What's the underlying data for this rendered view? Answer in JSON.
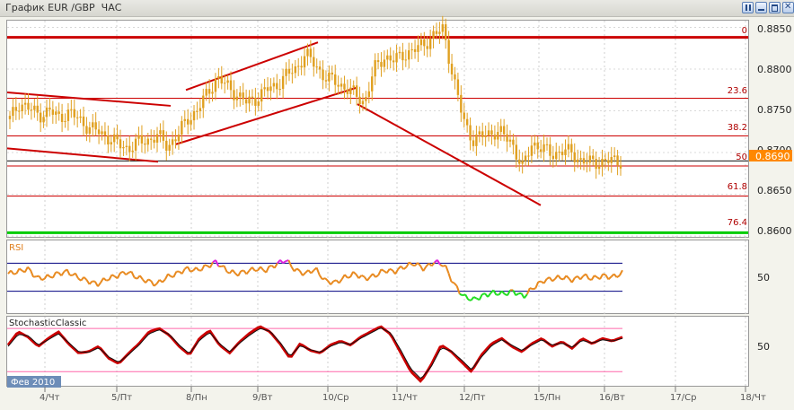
{
  "window": {
    "title": "График EUR /GBP  ЧАС",
    "buttons": [
      "pause",
      "minimize",
      "maximize",
      "close"
    ]
  },
  "price_panel": {
    "y_ticks": [
      "0.8850",
      "0.8800",
      "0.8750",
      "0.8700",
      "0.8650",
      "0.8600"
    ],
    "current_price": "0.8690",
    "fib_labels": [
      "0",
      "23.6",
      "38.2",
      "50",
      "61.8",
      "76.4"
    ],
    "colors": {
      "candles": "#e0a020",
      "fib": "#cc0000",
      "level_100": "#00cc00",
      "trend": "#cc0000",
      "price_tag": "#ff8800"
    }
  },
  "rsi_panel": {
    "label": "RSI",
    "y_tick": "50",
    "colors": {
      "line": "#e88a20",
      "overbought": "#dd22dd",
      "oversold": "#22dd22",
      "levels": "#000080"
    }
  },
  "stoch_panel": {
    "label": "StochasticClassic",
    "y_tick": "50",
    "colors": {
      "main": "#cc0000",
      "signal": "#111111",
      "levels": "#ff66aa"
    }
  },
  "date_badge": "Фев 2010",
  "x_ticks": [
    "4/Чт",
    "5/Пт",
    "8/Пн",
    "9/Вт",
    "10/Ср",
    "11/Чт",
    "12/Пт",
    "15/Пн",
    "16/Вт",
    "17/Ср",
    "18/Чт"
  ],
  "chart_data": [
    {
      "type": "candlestick",
      "title": "EUR /GBP",
      "x": [
        "4/Чт",
        "5/Пт",
        "8/Пн",
        "9/Вт",
        "10/Ср",
        "11/Чт",
        "12/Пт",
        "15/Пн",
        "16/Вт",
        "17/Ср",
        "18/Чт"
      ],
      "close_path": [
        0.874,
        0.876,
        0.8752,
        0.8745,
        0.875,
        0.8742,
        0.8748,
        0.874,
        0.873,
        0.8725,
        0.8718,
        0.871,
        0.8705,
        0.8712,
        0.8715,
        0.872,
        0.8708,
        0.872,
        0.874,
        0.875,
        0.877,
        0.879,
        0.878,
        0.877,
        0.876,
        0.8765,
        0.8775,
        0.878,
        0.8792,
        0.88,
        0.8818,
        0.8805,
        0.879,
        0.8785,
        0.8778,
        0.877,
        0.876,
        0.88,
        0.8815,
        0.881,
        0.8818,
        0.8822,
        0.883,
        0.884,
        0.8848,
        0.879,
        0.874,
        0.8715,
        0.872,
        0.8725,
        0.8722,
        0.8712,
        0.868,
        0.8712,
        0.8705,
        0.8698,
        0.8702,
        0.87,
        0.869,
        0.8688,
        0.8689,
        0.869,
        0.869
      ],
      "ylim": [
        0.8598,
        0.8858
      ],
      "current_price": 0.869,
      "fibonacci": [
        {
          "label": "0",
          "price": 0.8838
        },
        {
          "label": "23.6",
          "price": 0.8765
        },
        {
          "label": "38.2",
          "price": 0.872
        },
        {
          "label": "50",
          "price": 0.8684
        },
        {
          "label": "61.8",
          "price": 0.8648
        },
        {
          "label": "76.4",
          "price": 0.8604
        }
      ],
      "horizontal_line": 0.869,
      "trendlines": [
        {
          "from": [
            "4/Чт",
            0.8772
          ],
          "to": [
            "8/Пн",
            0.8756
          ]
        },
        {
          "from": [
            "4/Чт",
            0.8705
          ],
          "to": [
            "8/Пн",
            0.8689
          ]
        },
        {
          "from": [
            "8/Пн",
            0.8775
          ],
          "to": [
            "10/Ср",
            0.8832
          ]
        },
        {
          "from": [
            "8/Пн",
            0.871
          ],
          "to": [
            "11/Чт",
            0.8778
          ]
        },
        {
          "from": [
            "11/Чт",
            0.8758
          ],
          "to": [
            "15/Пн",
            0.8637
          ]
        }
      ]
    },
    {
      "type": "line",
      "title": "RSI",
      "ylim": [
        0,
        100
      ],
      "levels": [
        70,
        30
      ],
      "values": [
        55,
        58,
        62,
        48,
        50,
        55,
        58,
        50,
        45,
        40,
        48,
        52,
        58,
        50,
        45,
        40,
        50,
        55,
        62,
        60,
        65,
        72,
        60,
        55,
        58,
        62,
        60,
        68,
        75,
        60,
        55,
        62,
        45,
        42,
        50,
        55,
        48,
        52,
        60,
        58,
        65,
        70,
        62,
        72,
        68,
        40,
        22,
        18,
        24,
        28,
        26,
        30,
        22,
        35,
        45,
        48,
        50,
        46,
        52,
        48,
        52,
        50,
        56
      ]
    },
    {
      "type": "line",
      "title": "StochasticClassic",
      "ylim": [
        0,
        100
      ],
      "levels": [
        85,
        20
      ],
      "series": [
        {
          "values": [
            60,
            80,
            72,
            58,
            70,
            80,
            62,
            48,
            50,
            58,
            40,
            32,
            48,
            62,
            80,
            85,
            75,
            58,
            45,
            70,
            82,
            60,
            48,
            65,
            78,
            88,
            80,
            62,
            40,
            62,
            52,
            48,
            60,
            66,
            60,
            72,
            80,
            88,
            76,
            48,
            20,
            5,
            30,
            60,
            50,
            35,
            20,
            45,
            62,
            70,
            58,
            50,
            62,
            70,
            58,
            65,
            55,
            70,
            62,
            70,
            66,
            72
          ]
        },
        {
          "values": [
            58,
            76,
            74,
            60,
            68,
            77,
            64,
            50,
            49,
            56,
            42,
            34,
            46,
            60,
            77,
            83,
            76,
            60,
            47,
            67,
            79,
            62,
            50,
            63,
            75,
            85,
            81,
            64,
            43,
            59,
            53,
            49,
            58,
            64,
            61,
            70,
            78,
            86,
            78,
            52,
            24,
            9,
            27,
            56,
            51,
            38,
            23,
            42,
            59,
            68,
            60,
            52,
            60,
            68,
            60,
            63,
            57,
            67,
            63,
            68,
            66,
            70
          ]
        }
      ]
    }
  ]
}
